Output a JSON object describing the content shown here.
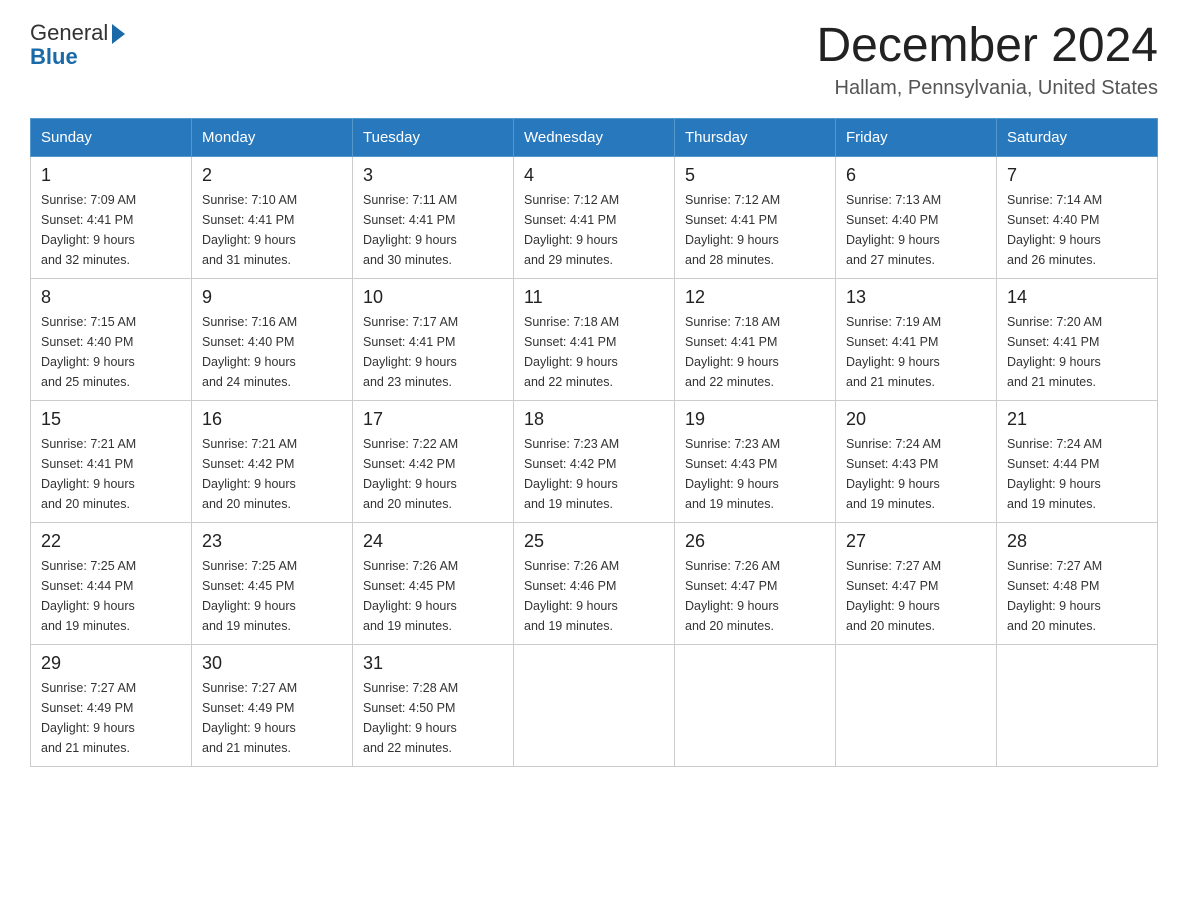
{
  "header": {
    "logo": {
      "general": "General",
      "arrow": "▶",
      "blue": "Blue"
    },
    "title": "December 2024",
    "location": "Hallam, Pennsylvania, United States"
  },
  "weekdays": [
    "Sunday",
    "Monday",
    "Tuesday",
    "Wednesday",
    "Thursday",
    "Friday",
    "Saturday"
  ],
  "weeks": [
    [
      {
        "day": "1",
        "sunrise": "7:09 AM",
        "sunset": "4:41 PM",
        "daylight": "9 hours and 32 minutes."
      },
      {
        "day": "2",
        "sunrise": "7:10 AM",
        "sunset": "4:41 PM",
        "daylight": "9 hours and 31 minutes."
      },
      {
        "day": "3",
        "sunrise": "7:11 AM",
        "sunset": "4:41 PM",
        "daylight": "9 hours and 30 minutes."
      },
      {
        "day": "4",
        "sunrise": "7:12 AM",
        "sunset": "4:41 PM",
        "daylight": "9 hours and 29 minutes."
      },
      {
        "day": "5",
        "sunrise": "7:12 AM",
        "sunset": "4:41 PM",
        "daylight": "9 hours and 28 minutes."
      },
      {
        "day": "6",
        "sunrise": "7:13 AM",
        "sunset": "4:40 PM",
        "daylight": "9 hours and 27 minutes."
      },
      {
        "day": "7",
        "sunrise": "7:14 AM",
        "sunset": "4:40 PM",
        "daylight": "9 hours and 26 minutes."
      }
    ],
    [
      {
        "day": "8",
        "sunrise": "7:15 AM",
        "sunset": "4:40 PM",
        "daylight": "9 hours and 25 minutes."
      },
      {
        "day": "9",
        "sunrise": "7:16 AM",
        "sunset": "4:40 PM",
        "daylight": "9 hours and 24 minutes."
      },
      {
        "day": "10",
        "sunrise": "7:17 AM",
        "sunset": "4:41 PM",
        "daylight": "9 hours and 23 minutes."
      },
      {
        "day": "11",
        "sunrise": "7:18 AM",
        "sunset": "4:41 PM",
        "daylight": "9 hours and 22 minutes."
      },
      {
        "day": "12",
        "sunrise": "7:18 AM",
        "sunset": "4:41 PM",
        "daylight": "9 hours and 22 minutes."
      },
      {
        "day": "13",
        "sunrise": "7:19 AM",
        "sunset": "4:41 PM",
        "daylight": "9 hours and 21 minutes."
      },
      {
        "day": "14",
        "sunrise": "7:20 AM",
        "sunset": "4:41 PM",
        "daylight": "9 hours and 21 minutes."
      }
    ],
    [
      {
        "day": "15",
        "sunrise": "7:21 AM",
        "sunset": "4:41 PM",
        "daylight": "9 hours and 20 minutes."
      },
      {
        "day": "16",
        "sunrise": "7:21 AM",
        "sunset": "4:42 PM",
        "daylight": "9 hours and 20 minutes."
      },
      {
        "day": "17",
        "sunrise": "7:22 AM",
        "sunset": "4:42 PM",
        "daylight": "9 hours and 20 minutes."
      },
      {
        "day": "18",
        "sunrise": "7:23 AM",
        "sunset": "4:42 PM",
        "daylight": "9 hours and 19 minutes."
      },
      {
        "day": "19",
        "sunrise": "7:23 AM",
        "sunset": "4:43 PM",
        "daylight": "9 hours and 19 minutes."
      },
      {
        "day": "20",
        "sunrise": "7:24 AM",
        "sunset": "4:43 PM",
        "daylight": "9 hours and 19 minutes."
      },
      {
        "day": "21",
        "sunrise": "7:24 AM",
        "sunset": "4:44 PM",
        "daylight": "9 hours and 19 minutes."
      }
    ],
    [
      {
        "day": "22",
        "sunrise": "7:25 AM",
        "sunset": "4:44 PM",
        "daylight": "9 hours and 19 minutes."
      },
      {
        "day": "23",
        "sunrise": "7:25 AM",
        "sunset": "4:45 PM",
        "daylight": "9 hours and 19 minutes."
      },
      {
        "day": "24",
        "sunrise": "7:26 AM",
        "sunset": "4:45 PM",
        "daylight": "9 hours and 19 minutes."
      },
      {
        "day": "25",
        "sunrise": "7:26 AM",
        "sunset": "4:46 PM",
        "daylight": "9 hours and 19 minutes."
      },
      {
        "day": "26",
        "sunrise": "7:26 AM",
        "sunset": "4:47 PM",
        "daylight": "9 hours and 20 minutes."
      },
      {
        "day": "27",
        "sunrise": "7:27 AM",
        "sunset": "4:47 PM",
        "daylight": "9 hours and 20 minutes."
      },
      {
        "day": "28",
        "sunrise": "7:27 AM",
        "sunset": "4:48 PM",
        "daylight": "9 hours and 20 minutes."
      }
    ],
    [
      {
        "day": "29",
        "sunrise": "7:27 AM",
        "sunset": "4:49 PM",
        "daylight": "9 hours and 21 minutes."
      },
      {
        "day": "30",
        "sunrise": "7:27 AM",
        "sunset": "4:49 PM",
        "daylight": "9 hours and 21 minutes."
      },
      {
        "day": "31",
        "sunrise": "7:28 AM",
        "sunset": "4:50 PM",
        "daylight": "9 hours and 22 minutes."
      },
      null,
      null,
      null,
      null
    ]
  ]
}
